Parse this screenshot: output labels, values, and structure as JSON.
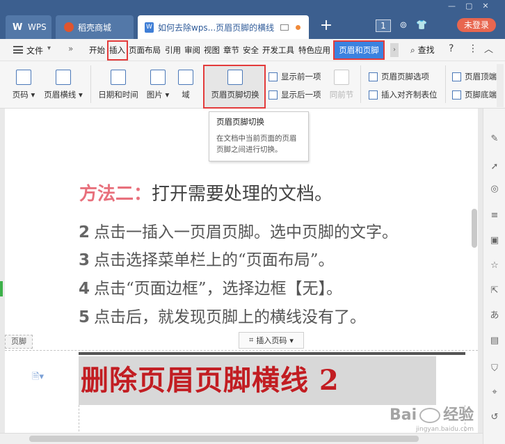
{
  "titlebar": {
    "tabs": [
      {
        "label": "WPS"
      },
      {
        "label": "稻壳商城"
      },
      {
        "label": "如何去除wps...页眉页脚的横线"
      }
    ],
    "new_tab": "+",
    "badge": "1",
    "login": "未登录"
  },
  "menubar": {
    "file": "文件",
    "tabs": [
      "开始",
      "插入",
      "页面布局",
      "引用",
      "审阅",
      "视图",
      "章节",
      "安全",
      "开发工具",
      "特色应用"
    ],
    "active_tab": "页眉和页脚",
    "search": "查找",
    "help": "?",
    "more": "⋮"
  },
  "ribbon": {
    "page_number": "页码",
    "header_line": "页眉横线",
    "date_time": "日期和时间",
    "picture": "图片",
    "field": "域",
    "hf_switch": "页眉页脚切换",
    "show_prev": "显示前一项",
    "show_next": "显示后一项",
    "same_as_prev": "同前节",
    "hf_options": "页眉页脚选项",
    "insert_tab": "插入对齐制表位",
    "header_top": "页眉顶端",
    "footer_bottom": "页脚底端"
  },
  "tooltip": {
    "title": "页眉页脚切换",
    "desc": "在文档中当前页面的页眉页脚之间进行切换。"
  },
  "document": {
    "method_label": "方法二：",
    "method_text": "打开需要处理的文档。",
    "steps": [
      {
        "num": "2",
        "text": "点击一插入一页眉页脚。选中页脚的文字。"
      },
      {
        "num": "3",
        "text": "点击选择菜单栏上的“页面布局”。"
      },
      {
        "num": "4",
        "text": "点击“页面边框”，选择边框【无】。"
      },
      {
        "num": "5",
        "text": "点击后，就发现页脚上的横线没有了。"
      }
    ],
    "footer_tag": "页脚",
    "insert_page_number": "插入页码",
    "caption": "删除页眉页脚横线 2"
  },
  "watermark": {
    "text_left": "Bai",
    "text_right": "经验",
    "sub": "jingyan.baidu.com"
  },
  "colors": {
    "titlebar": "#3c5f8f",
    "accent_blue": "#3b82e0",
    "highlight_red": "#e33b3b",
    "method_label": "#e8707c",
    "caption_red": "#c21d22",
    "login_btn": "#e8664f"
  }
}
